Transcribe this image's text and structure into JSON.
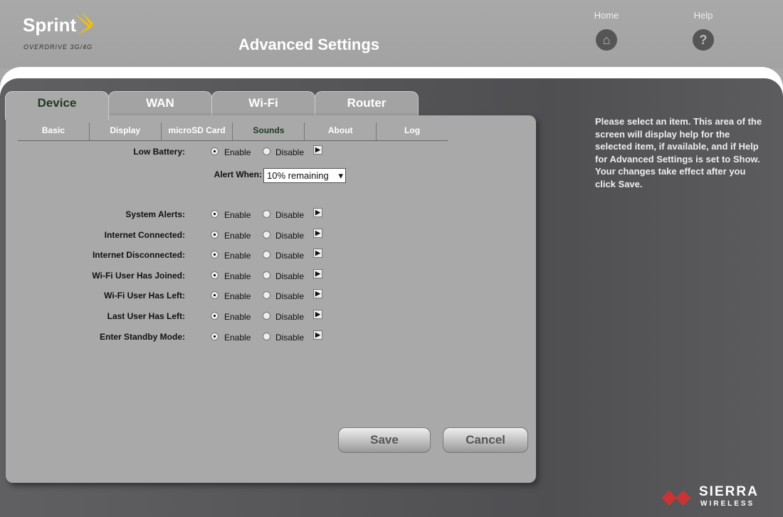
{
  "header": {
    "brand": "Sprint",
    "sub_brand": "OVERDRIVE 3G/4G",
    "title": "Advanced Settings",
    "nav": [
      {
        "label": "Home",
        "icon": "home-icon"
      },
      {
        "label": "Help",
        "icon": "help-icon"
      }
    ]
  },
  "tabs": [
    {
      "label": "Device",
      "active": true
    },
    {
      "label": "WAN"
    },
    {
      "label": "Wi-Fi"
    },
    {
      "label": "Router"
    }
  ],
  "subtabs": [
    {
      "label": "Basic"
    },
    {
      "label": "Display"
    },
    {
      "label": "microSD Card"
    },
    {
      "label": "Sounds",
      "active": true
    },
    {
      "label": "About"
    },
    {
      "label": "Log"
    }
  ],
  "options": {
    "enable": "Enable",
    "disable": "Disable"
  },
  "alert_when": {
    "label": "Alert When:",
    "value": "10% remaining"
  },
  "settings": [
    {
      "label": "Low Battery:",
      "value": "Enable"
    },
    {
      "label": "System Alerts:",
      "value": "Enable"
    },
    {
      "label": "Internet Connected:",
      "value": "Enable"
    },
    {
      "label": "Internet Disconnected:",
      "value": "Enable"
    },
    {
      "label": "Wi-Fi User Has Joined:",
      "value": "Enable"
    },
    {
      "label": "Wi-Fi User Has Left:",
      "value": "Enable"
    },
    {
      "label": "Last User Has Left:",
      "value": "Enable"
    },
    {
      "label": "Enter Standby Mode:",
      "value": "Enable"
    }
  ],
  "buttons": {
    "save": "Save",
    "cancel": "Cancel"
  },
  "help_text": [
    "Please select an item. This area of the screen will display help for the selected item, if available, and if Help for Advanced Settings is set to Show.",
    "Your changes take effect after you click Save."
  ],
  "footer_logo": {
    "name": "SIERRA",
    "sub": "WIRELESS"
  },
  "colors": {
    "active_tab_text": "#1f3a1f",
    "logo_accent": "#f2c200",
    "sierra_red": "#cc3333"
  }
}
